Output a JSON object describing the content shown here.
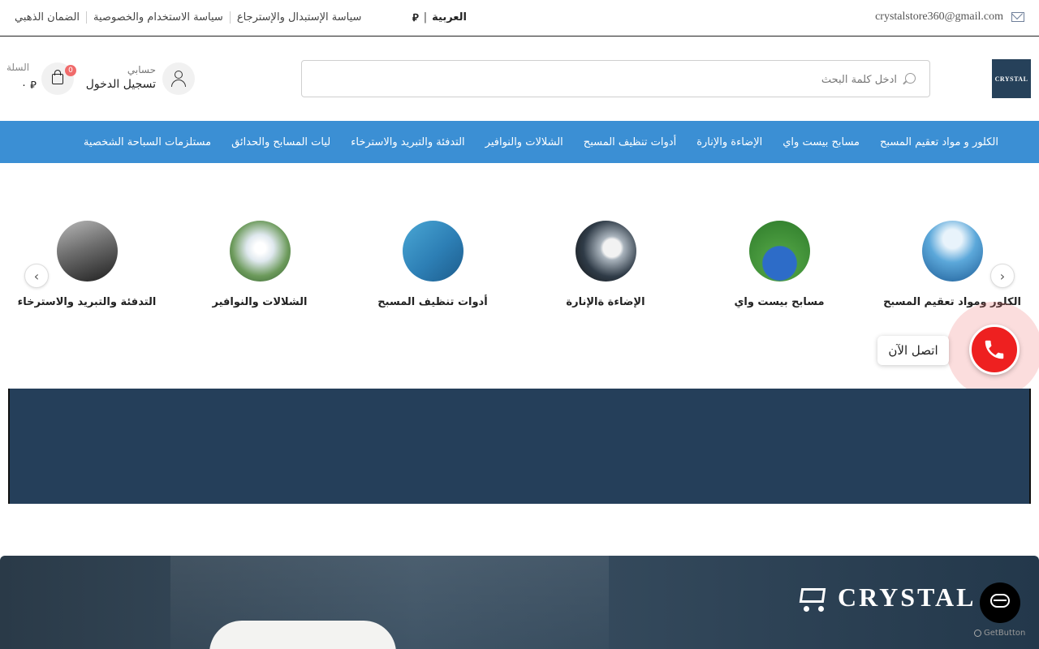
{
  "topbar": {
    "email": "crystalstore360@gmail.com",
    "links": [
      "سياسة الإستبدال والإسترجاع",
      "سياسة الاستخدام والخصوصية",
      "الضمان الذهبي"
    ],
    "language": "العربية",
    "currency_symbol": "⃁"
  },
  "header": {
    "logo_text": "CRYSTAL",
    "search_placeholder": "ادخل كلمة البحث",
    "account_small": "حسابي",
    "account_login": "تسجيل الدخول",
    "cart_label": "السلة",
    "cart_count": "0",
    "cart_total": "٠ ⃁"
  },
  "nav": {
    "items": [
      "الكلور و مواد تعقيم المسبح",
      "مسابح بيست واي",
      "الإضاءة والإنارة",
      "أدوات تنظيف المسبح",
      "الشلالات والنوافير",
      "التدفئة والتبريد والاسترخاء",
      "ليات المسابح والحدائق",
      "مستلزمات السباحة الشخصية"
    ]
  },
  "categories": {
    "items": [
      {
        "label": "الكلور ومواد تعقيم المسبح",
        "icon": "chlorine-image"
      },
      {
        "label": "مسابح بيست واي",
        "icon": "pool-image"
      },
      {
        "label": "الإضاءة ةالإنارة",
        "icon": "light-image"
      },
      {
        "label": "أدوات تنظيف المسبح",
        "icon": "cleaning-tool-image"
      },
      {
        "label": "الشلالات والنوافير",
        "icon": "fountain-image"
      },
      {
        "label": "التدفئة والتبريد والاسترخاء",
        "icon": "heater-image"
      }
    ],
    "prev_arrow": "‹",
    "next_arrow": "›"
  },
  "call": {
    "label": "اتصل الآن",
    "icon": "phone-icon",
    "color": "#ee2020"
  },
  "promo": {
    "brand": "CRYSTAL"
  },
  "widget": {
    "getbutton": "GetButton"
  },
  "colors": {
    "nav": "#3b8fd4",
    "banner": "#253f5a",
    "cart_badge": "#f06b6b"
  }
}
